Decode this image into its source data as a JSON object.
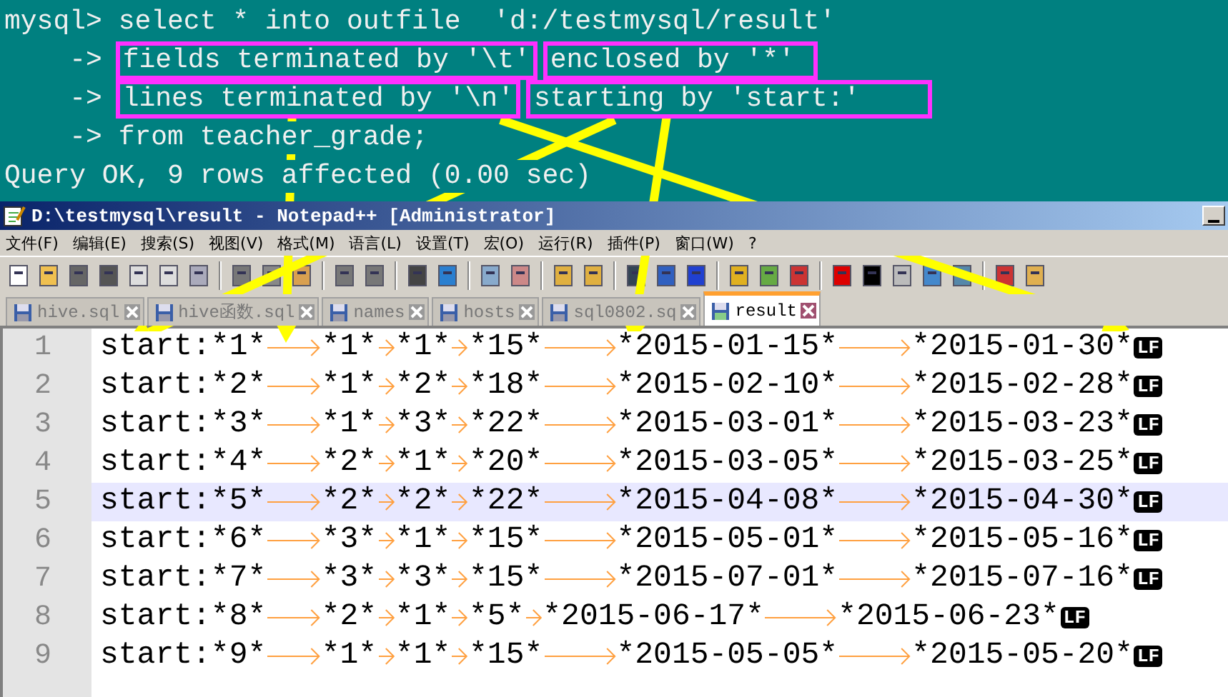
{
  "terminal": {
    "lines": [
      {
        "segments": [
          {
            "text": "mysql> select * into outfile  'd:/testmysql/result'",
            "boxed": false
          }
        ]
      },
      {
        "segments": [
          {
            "text": "    -> ",
            "boxed": false
          },
          {
            "text": "fields terminated by '\\t'",
            "boxed": true
          },
          {
            "text": "enclosed by '*' ",
            "boxed": true
          }
        ]
      },
      {
        "segments": [
          {
            "text": "    -> ",
            "boxed": false
          },
          {
            "text": "lines terminated by '\\n'",
            "boxed": true
          },
          {
            "text": "starting by 'start:'    ",
            "boxed": true
          }
        ]
      },
      {
        "segments": [
          {
            "text": "    -> from teacher_grade;",
            "boxed": false
          }
        ]
      },
      {
        "segments": [
          {
            "text": "Query OK, 9 rows affected (0.00 sec)",
            "boxed": false
          }
        ]
      }
    ]
  },
  "window": {
    "title": "D:\\testmysql\\result - Notepad++ [Administrator]"
  },
  "menu": [
    "文件(F)",
    "编辑(E)",
    "搜索(S)",
    "视图(V)",
    "格式(M)",
    "语言(L)",
    "设置(T)",
    "宏(O)",
    "运行(R)",
    "插件(P)",
    "窗口(W)",
    "?"
  ],
  "tabs": [
    {
      "label": "hive.sql",
      "selected": false
    },
    {
      "label": "hive函数.sql",
      "selected": false
    },
    {
      "label": "names",
      "selected": false
    },
    {
      "label": "hosts",
      "selected": false
    },
    {
      "label": "sql0802.sq",
      "selected": false
    },
    {
      "label": "result",
      "selected": true
    }
  ],
  "editor": {
    "lines": [
      {
        "number": "1",
        "current": false,
        "fields": [
          "start:*1*",
          "*1*",
          "*1*",
          "*15*",
          "*2015-01-15*",
          "*2015-01-30*"
        ],
        "eol": "LF"
      },
      {
        "number": "2",
        "current": false,
        "fields": [
          "start:*2*",
          "*1*",
          "*2*",
          "*18*",
          "*2015-02-10*",
          "*2015-02-28*"
        ],
        "eol": "LF"
      },
      {
        "number": "3",
        "current": false,
        "fields": [
          "start:*3*",
          "*1*",
          "*3*",
          "*22*",
          "*2015-03-01*",
          "*2015-03-23*"
        ],
        "eol": "LF"
      },
      {
        "number": "4",
        "current": false,
        "fields": [
          "start:*4*",
          "*2*",
          "*1*",
          "*20*",
          "*2015-03-05*",
          "*2015-03-25*"
        ],
        "eol": "LF"
      },
      {
        "number": "5",
        "current": true,
        "fields": [
          "start:*5*",
          "*2*",
          "*2*",
          "*22*",
          "*2015-04-08*",
          "*2015-04-30*"
        ],
        "eol": "LF"
      },
      {
        "number": "6",
        "current": false,
        "fields": [
          "start:*6*",
          "*3*",
          "*1*",
          "*15*",
          "*2015-05-01*",
          "*2015-05-16*"
        ],
        "eol": "LF"
      },
      {
        "number": "7",
        "current": false,
        "fields": [
          "start:*7*",
          "*3*",
          "*3*",
          "*15*",
          "*2015-07-01*",
          "*2015-07-16*"
        ],
        "eol": "LF"
      },
      {
        "number": "8",
        "current": false,
        "fields": [
          "start:*8*",
          "*2*",
          "*1*",
          "*5*",
          "*2015-06-17*",
          "*2015-06-23*"
        ],
        "eol": "LF"
      },
      {
        "number": "9",
        "current": false,
        "fields": [
          "start:*9*",
          "*1*",
          "*1*",
          "*15*",
          "*2015-05-05*",
          "*2015-05-20*"
        ],
        "eol": "LF"
      }
    ]
  }
}
